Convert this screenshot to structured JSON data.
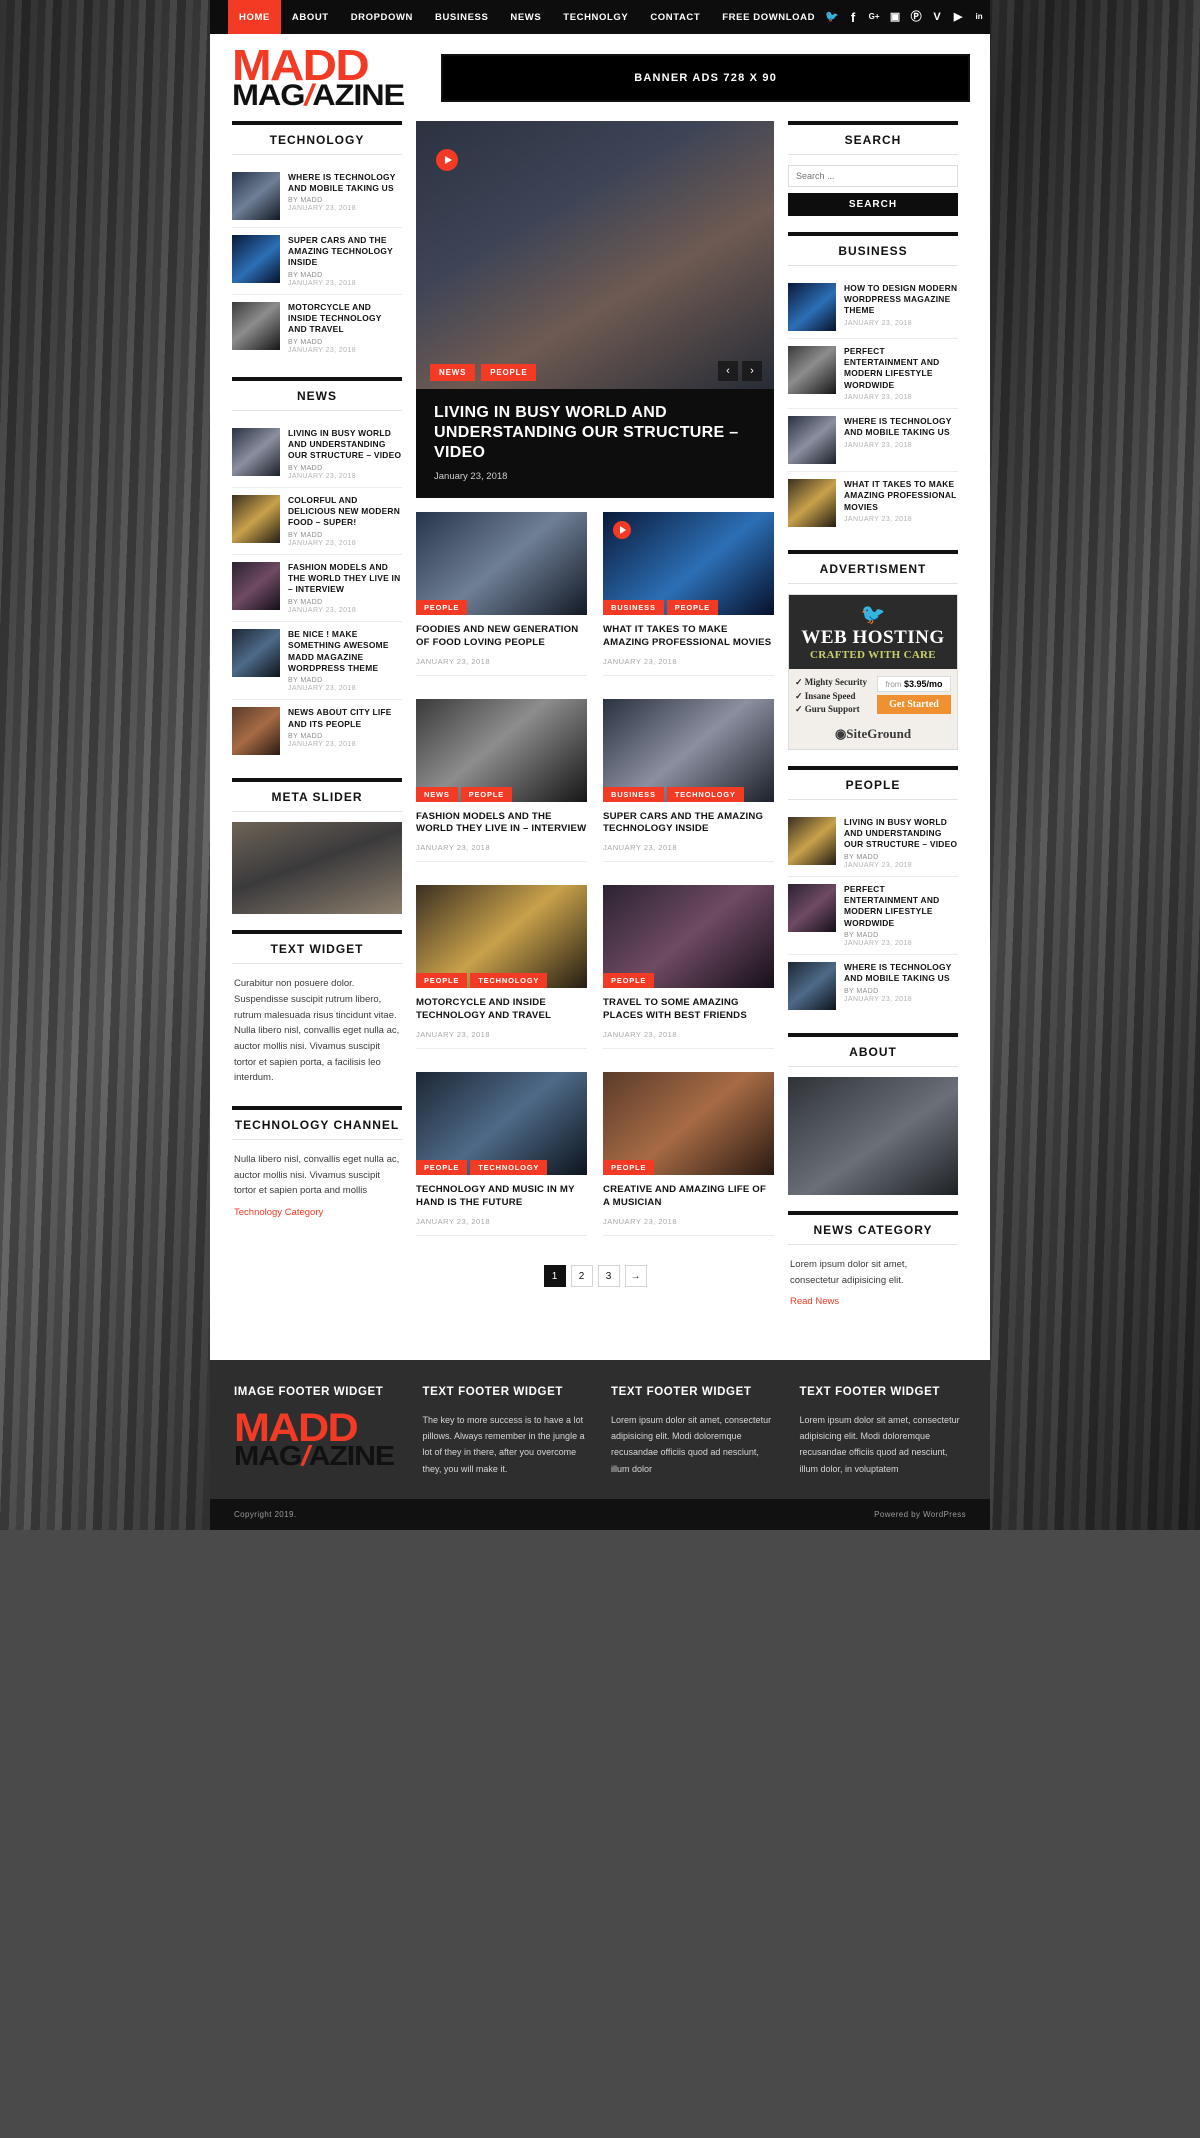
{
  "nav": {
    "items": [
      {
        "label": "HOME",
        "active": true
      },
      {
        "label": "ABOUT",
        "active": false
      },
      {
        "label": "DROPDOWN",
        "active": false
      },
      {
        "label": "BUSINESS",
        "active": false
      },
      {
        "label": "NEWS",
        "active": false
      },
      {
        "label": "TECHNOLGY",
        "active": false
      },
      {
        "label": "CONTACT",
        "active": false
      },
      {
        "label": "FREE DOWNLOAD",
        "active": false
      }
    ],
    "social": [
      "twitter-icon",
      "facebook-icon",
      "google-plus-icon",
      "instagram-icon",
      "pinterest-icon",
      "vimeo-icon",
      "youtube-icon",
      "linkedin-icon"
    ]
  },
  "header": {
    "logo_line1": "MADD",
    "logo_line2_a": "MAG",
    "logo_slash": "/",
    "logo_line2_b": "AZINE",
    "banner_ad": "BANNER ADS 728 X 90"
  },
  "colors": {
    "accent": "#f23a24",
    "dark": "#0d0d0d",
    "footer_bg": "#2e2e2e",
    "meta_gray": "#a8a8a8"
  },
  "left_sidebar": {
    "technology": {
      "title": "TECHNOLOGY",
      "posts": [
        {
          "title": "WHERE IS TECHNOLOGY AND MOBILE TAKING US",
          "author": "BY MADD",
          "date": "JANUARY 23, 2018"
        },
        {
          "title": "SUPER CARS AND THE AMAZING TECHNOLOGY INSIDE",
          "author": "BY MADD",
          "date": "JANUARY 23, 2018"
        },
        {
          "title": "MOTORCYCLE AND INSIDE TECHNOLOGY AND TRAVEL",
          "author": "BY MADD",
          "date": "JANUARY 23, 2018"
        }
      ]
    },
    "news": {
      "title": "NEWS",
      "posts": [
        {
          "title": "LIVING IN BUSY WORLD AND UNDERSTANDING OUR STRUCTURE – VIDEO",
          "author": "BY MADD",
          "date": "JANUARY 23, 2018"
        },
        {
          "title": "COLORFUL AND DELICIOUS NEW MODERN FOOD – SUPER!",
          "author": "BY MADD",
          "date": "JANUARY 23, 2018"
        },
        {
          "title": "FASHION MODELS AND THE WORLD THEY LIVE IN – INTERVIEW",
          "author": "BY MADD",
          "date": "JANUARY 23, 2018"
        },
        {
          "title": "BE NICE ! MAKE SOMETHING AWESOME MADD MAGAZINE WORDPRESS THEME",
          "author": "BY MADD",
          "date": "JANUARY 23, 2018"
        },
        {
          "title": "NEWS ABOUT CITY LIFE AND ITS PEOPLE",
          "author": "BY MADD",
          "date": "JANUARY 23, 2018"
        }
      ]
    },
    "meta_slider": {
      "title": "META SLIDER"
    },
    "text_widget": {
      "title": "TEXT WIDGET",
      "body": "Curabitur non posuere dolor. Suspendisse suscipit rutrum libero, rutrum malesuada risus tincidunt vitae. Nulla libero nisl, convallis eget nulla ac, auctor mollis nisi. Vivamus suscipit tortor et sapien porta, a facilisis leo interdum."
    },
    "technology_channel": {
      "title": "TECHNOLOGY CHANNEL",
      "body": "Nulla libero nisl, convallis eget nulla ac, auctor mollis nisi. Vivamus suscipit tortor et sapien porta and mollis",
      "link": "Technology Category"
    }
  },
  "hero": {
    "categories": [
      "NEWS",
      "PEOPLE"
    ],
    "title": "LIVING IN BUSY WORLD AND UNDERSTANDING OUR STRUCTURE – VIDEO",
    "date": "January 23, 2018",
    "prev": "‹",
    "next": "›",
    "play": "play-icon"
  },
  "grid": [
    {
      "categories": [
        "PEOPLE"
      ],
      "title": "FOODIES AND NEW GENERATION OF FOOD LOVING PEOPLE",
      "date": "JANUARY 23, 2018",
      "video": false
    },
    {
      "categories": [
        "BUSINESS",
        "PEOPLE"
      ],
      "title": "WHAT IT TAKES TO MAKE AMAZING PROFESSIONAL MOVIES",
      "date": "JANUARY 23, 2018",
      "video": true
    },
    {
      "categories": [
        "NEWS",
        "PEOPLE"
      ],
      "title": "FASHION MODELS AND THE WORLD THEY LIVE IN – INTERVIEW",
      "date": "JANUARY 23, 2018",
      "video": false
    },
    {
      "categories": [
        "BUSINESS",
        "TECHNOLOGY"
      ],
      "title": "SUPER CARS AND THE AMAZING TECHNOLOGY INSIDE",
      "date": "JANUARY 23, 2018",
      "video": false
    },
    {
      "categories": [
        "PEOPLE",
        "TECHNOLOGY"
      ],
      "title": "MOTORCYCLE AND INSIDE TECHNOLOGY AND TRAVEL",
      "date": "JANUARY 23, 2018",
      "video": false
    },
    {
      "categories": [
        "PEOPLE"
      ],
      "title": "TRAVEL TO SOME AMAZING PLACES WITH BEST FRIENDS",
      "date": "JANUARY 23, 2018",
      "video": false
    },
    {
      "categories": [
        "PEOPLE",
        "TECHNOLOGY"
      ],
      "title": "TECHNOLOGY AND MUSIC IN MY HAND IS THE FUTURE",
      "date": "JANUARY 23, 2018",
      "video": false
    },
    {
      "categories": [
        "PEOPLE"
      ],
      "title": "CREATIVE AND AMAZING LIFE OF A MUSICIAN",
      "date": "JANUARY 23, 2018",
      "video": false
    }
  ],
  "pagination": {
    "pages": [
      "1",
      "2",
      "3"
    ],
    "next": "→",
    "current": "1"
  },
  "right_sidebar": {
    "search": {
      "title": "SEARCH",
      "placeholder": "Search ...",
      "value": "",
      "button": "SEARCH"
    },
    "business": {
      "title": "BUSINESS",
      "posts": [
        {
          "title": "HOW TO DESIGN MODERN WORDPRESS MAGAZINE THEME",
          "date": "JANUARY 23, 2018"
        },
        {
          "title": "PERFECT ENTERTAINMENT AND MODERN LIFESTYLE WORDWIDE",
          "date": "JANUARY 23, 2018"
        },
        {
          "title": "WHERE IS TECHNOLOGY AND MOBILE TAKING US",
          "date": "JANUARY 23, 2018"
        },
        {
          "title": "WHAT IT TAKES TO MAKE AMAZING PROFESSIONAL MOVIES",
          "date": "JANUARY 23, 2018"
        }
      ]
    },
    "advertisment": {
      "title": "ADVERTISMENT",
      "ad_headline": "WEB HOSTING",
      "ad_subhead": "CRAFTED WITH CARE",
      "features": [
        "Mighty Security",
        "Insane Speed",
        "Guru Support"
      ],
      "price_from": "from",
      "price": "$3.95/mo",
      "cta": "Get Started",
      "brand": "SiteGround"
    },
    "people": {
      "title": "PEOPLE",
      "posts": [
        {
          "title": "LIVING IN BUSY WORLD AND UNDERSTANDING OUR STRUCTURE – VIDEO",
          "author": "BY MADD",
          "date": "JANUARY 23, 2018"
        },
        {
          "title": "PERFECT ENTERTAINMENT AND MODERN LIFESTYLE WORDWIDE",
          "author": "BY MADD",
          "date": "JANUARY 23, 2018"
        },
        {
          "title": "WHERE IS TECHNOLOGY AND MOBILE TAKING US",
          "author": "BY MADD",
          "date": "JANUARY 23, 2018"
        }
      ]
    },
    "about": {
      "title": "ABOUT"
    },
    "news_category": {
      "title": "NEWS CATEGORY",
      "body": "Lorem ipsum dolor sit amet, consectetur adipisicing elit.",
      "link": "Read News"
    }
  },
  "footer": {
    "columns": [
      {
        "heading": "IMAGE FOOTER WIDGET",
        "type": "logo",
        "body": ""
      },
      {
        "heading": "TEXT FOOTER WIDGET",
        "type": "text",
        "body": "The key to more success is to have a lot pillows. Always remember in the jungle a lot of they in there, after you overcome they, you will make it."
      },
      {
        "heading": "TEXT FOOTER WIDGET",
        "type": "text",
        "body": "Lorem ipsum dolor sit amet, consectetur adipisicing elit. Modi doloremque recusandae officiis quod ad nesciunt, illum dolor"
      },
      {
        "heading": "TEXT FOOTER WIDGET",
        "type": "text",
        "body": "Lorem ipsum dolor sit amet, consectetur adipisicing elit. Modi doloremque recusandae officiis quod ad nesciunt, illum dolor, in voluptatem"
      }
    ],
    "copyright": "Copyright 2019.",
    "powered": "Powered by WordPress"
  }
}
